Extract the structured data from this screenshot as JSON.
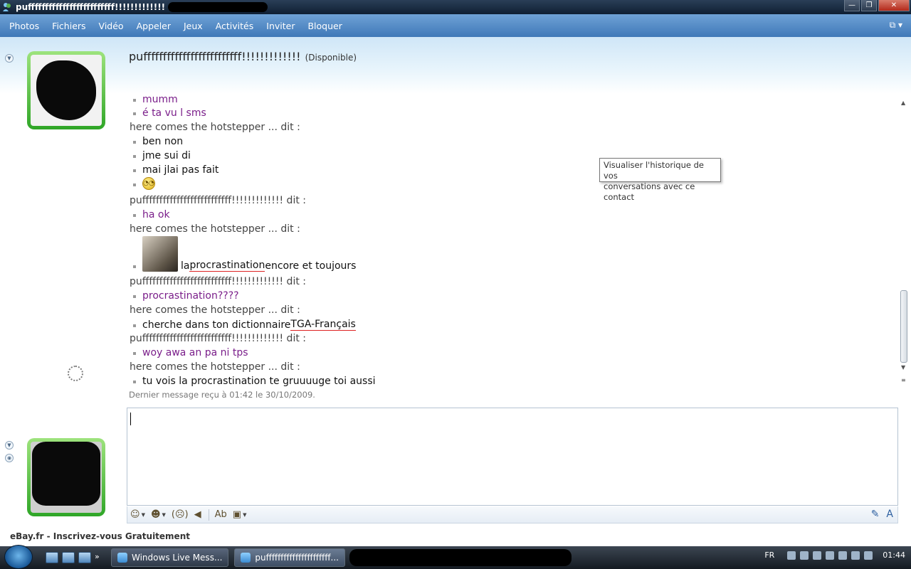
{
  "window": {
    "title": "pufffffffffffffffffffffffff!!!!!!!!!!!!!",
    "buttons": {
      "minimize": "—",
      "maximize": "❐",
      "close": "✕"
    }
  },
  "menu": {
    "items": [
      "Photos",
      "Fichiers",
      "Vidéo",
      "Appeler",
      "Jeux",
      "Activités",
      "Inviter",
      "Bloquer"
    ],
    "right_icon": "⧉ ▾"
  },
  "contact": {
    "name": "pufffffffffffffffffffffffff!!!!!!!!!!!!!",
    "status": "(Disponible)"
  },
  "conversation": {
    "messages": [
      {
        "kind": "msg",
        "text": "mumm",
        "color": "purple"
      },
      {
        "kind": "msg",
        "text": "é ta vu l sms",
        "color": "purple"
      },
      {
        "kind": "sender",
        "text": "here comes the hotstepper ... dit :"
      },
      {
        "kind": "msg",
        "text": "ben non",
        "color": "black"
      },
      {
        "kind": "msg",
        "text": "jme sui di",
        "color": "black"
      },
      {
        "kind": "msg",
        "text": "mai jlai pas fait",
        "color": "black"
      },
      {
        "kind": "emoticon",
        "text": "◔◔"
      },
      {
        "kind": "sender",
        "text": "puffffffffffffffffffffffffff!!!!!!!!!!!!! dit :"
      },
      {
        "kind": "msg",
        "text": "ha ok",
        "color": "purple"
      },
      {
        "kind": "sender",
        "text": "here comes the hotstepper ... dit :"
      },
      {
        "kind": "photo-msg",
        "pre": "la ",
        "underlined": "procrastination",
        "post": " encore et toujours"
      },
      {
        "kind": "sender",
        "text": "puffffffffffffffffffffffffff!!!!!!!!!!!!! dit :"
      },
      {
        "kind": "msg",
        "text": "procrastination????",
        "color": "purple"
      },
      {
        "kind": "sender",
        "text": "here comes the hotstepper ... dit :"
      },
      {
        "kind": "underline-msg",
        "pre": "cherche dans ton dictionnaire ",
        "underlined": "TGA-Français"
      },
      {
        "kind": "sender",
        "text": "puffffffffffffffffffffffffff!!!!!!!!!!!!! dit :"
      },
      {
        "kind": "msg",
        "text": "woy awa an pa ni tps",
        "color": "purple"
      },
      {
        "kind": "sender",
        "text": "here comes the hotstepper ... dit :"
      },
      {
        "kind": "msg",
        "text": "tu vois la procrastination te gruuuuge toi aussi",
        "color": "black"
      }
    ],
    "last_received": "Dernier message reçu à 01:42 le 30/10/2009."
  },
  "tooltip": {
    "line1": "Visualiser l'historique de vos",
    "line2": "conversations avec ce contact"
  },
  "toolbar": {
    "emoticons": "☺",
    "winks": "☻",
    "nudge": "(☹)",
    "voice": "◀",
    "font": "Ab",
    "backgrounds": "▣",
    "handwriting": "✎",
    "text_style": "A"
  },
  "ad": {
    "text": "eBay.fr - Inscrivez-vous Gratuitement"
  },
  "taskbar": {
    "tasks": [
      {
        "label": "Windows Live Mess..."
      },
      {
        "label": "puffffffffffffffffffffff..."
      }
    ],
    "language": "FR",
    "clock": "01:44"
  }
}
